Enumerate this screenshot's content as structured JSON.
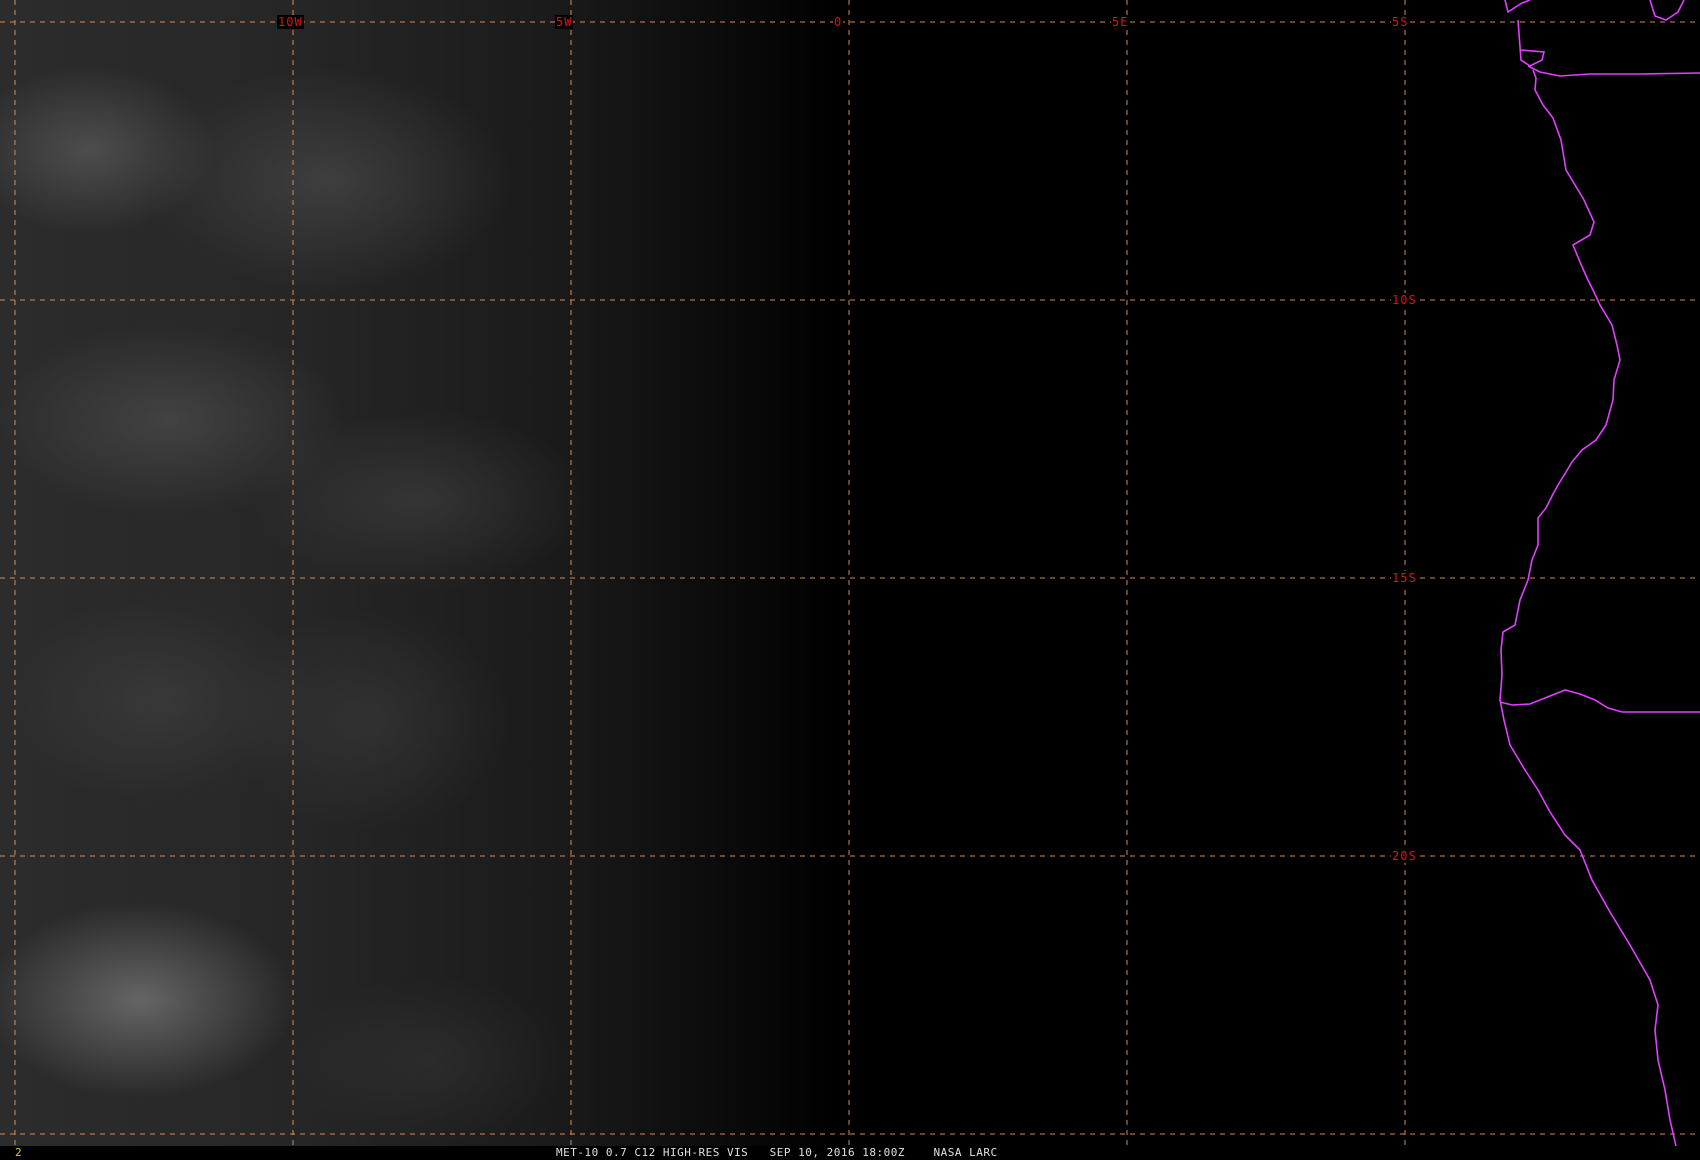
{
  "longitude_labels": [
    {
      "text": "10W",
      "lon": -10
    },
    {
      "text": "5W",
      "lon": -5
    },
    {
      "text": "0",
      "lon": 0
    },
    {
      "text": "5E",
      "lon": 5
    }
  ],
  "latitude_labels": [
    {
      "text": "5S",
      "lat": -5
    },
    {
      "text": "10S",
      "lat": -10
    },
    {
      "text": "15S",
      "lat": -15
    },
    {
      "text": "20S",
      "lat": -20
    }
  ],
  "colors": {
    "background": "#000000",
    "gridline": "#d28a5a",
    "grid_label": "#e01010",
    "coastline": "#e040ff",
    "caption_text": "#e0e0e0",
    "frame_number": "#e0d020"
  },
  "caption": {
    "frame_number": "2",
    "text": "MET-10 0.7 C12 HIGH-RES VIS   SEP 10, 2016 18:00Z    NASA LARC"
  }
}
